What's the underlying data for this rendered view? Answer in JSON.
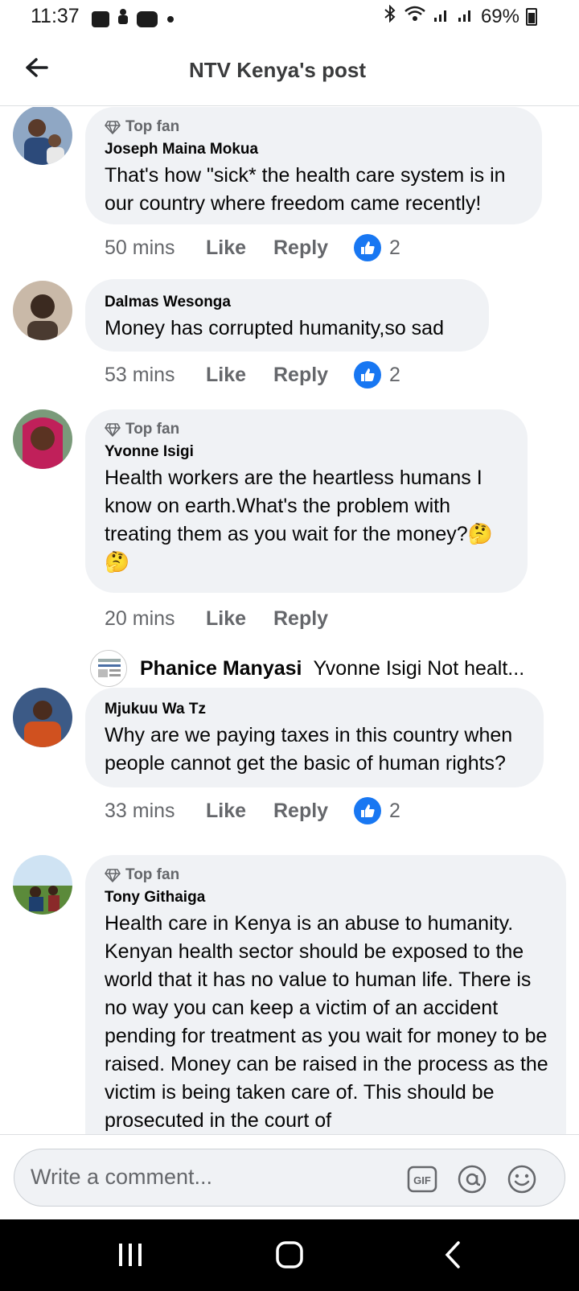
{
  "status": {
    "time": "11:37",
    "battery": "69%"
  },
  "header": {
    "title": "NTV Kenya's post"
  },
  "comments": [
    {
      "badge": "Top fan",
      "author": "Joseph Maina Mokua",
      "text": "That's how \"sick* the health care system is in our country where freedom came recently!",
      "time": "50 mins",
      "like": "Like",
      "reply": "Reply",
      "reactions": "2"
    },
    {
      "author": "Dalmas Wesonga",
      "text": "Money has corrupted humanity,so sad",
      "time": "53 mins",
      "like": "Like",
      "reply": "Reply",
      "reactions": "2"
    },
    {
      "badge": "Top fan",
      "author": "Yvonne Isigi",
      "text": "Health workers are the heartless humans I know on earth.What's the problem with treating them as you wait for the money?🤔🤔",
      "time": "20 mins",
      "like": "Like",
      "reply": "Reply"
    },
    {
      "author": "Mjukuu Wa Tz",
      "text": "Why are we paying taxes in this country when people cannot get the basic of human rights?",
      "time": "33 mins",
      "like": "Like",
      "reply": "Reply",
      "reactions": "2"
    },
    {
      "badge": "Top fan",
      "author": "Tony Githaiga",
      "text": "Health care in Kenya is an abuse to humanity. Kenyan health sector should be exposed to the world that it has no value to human life. There is no way you can keep a victim of an accident pending for treatment as you wait for money to be raised. Money can be raised in the process as the victim is being taken care of. This should be prosecuted in the court of"
    }
  ],
  "reply_preview": {
    "author": "Phanice Manyasi",
    "text": "Yvonne Isigi  Not healt..."
  },
  "composer": {
    "placeholder": "Write a comment...",
    "gif_label": "GIF"
  },
  "colors": {
    "accent": "#1877f2",
    "bubble": "#f0f2f5",
    "muted": "#65676b"
  }
}
